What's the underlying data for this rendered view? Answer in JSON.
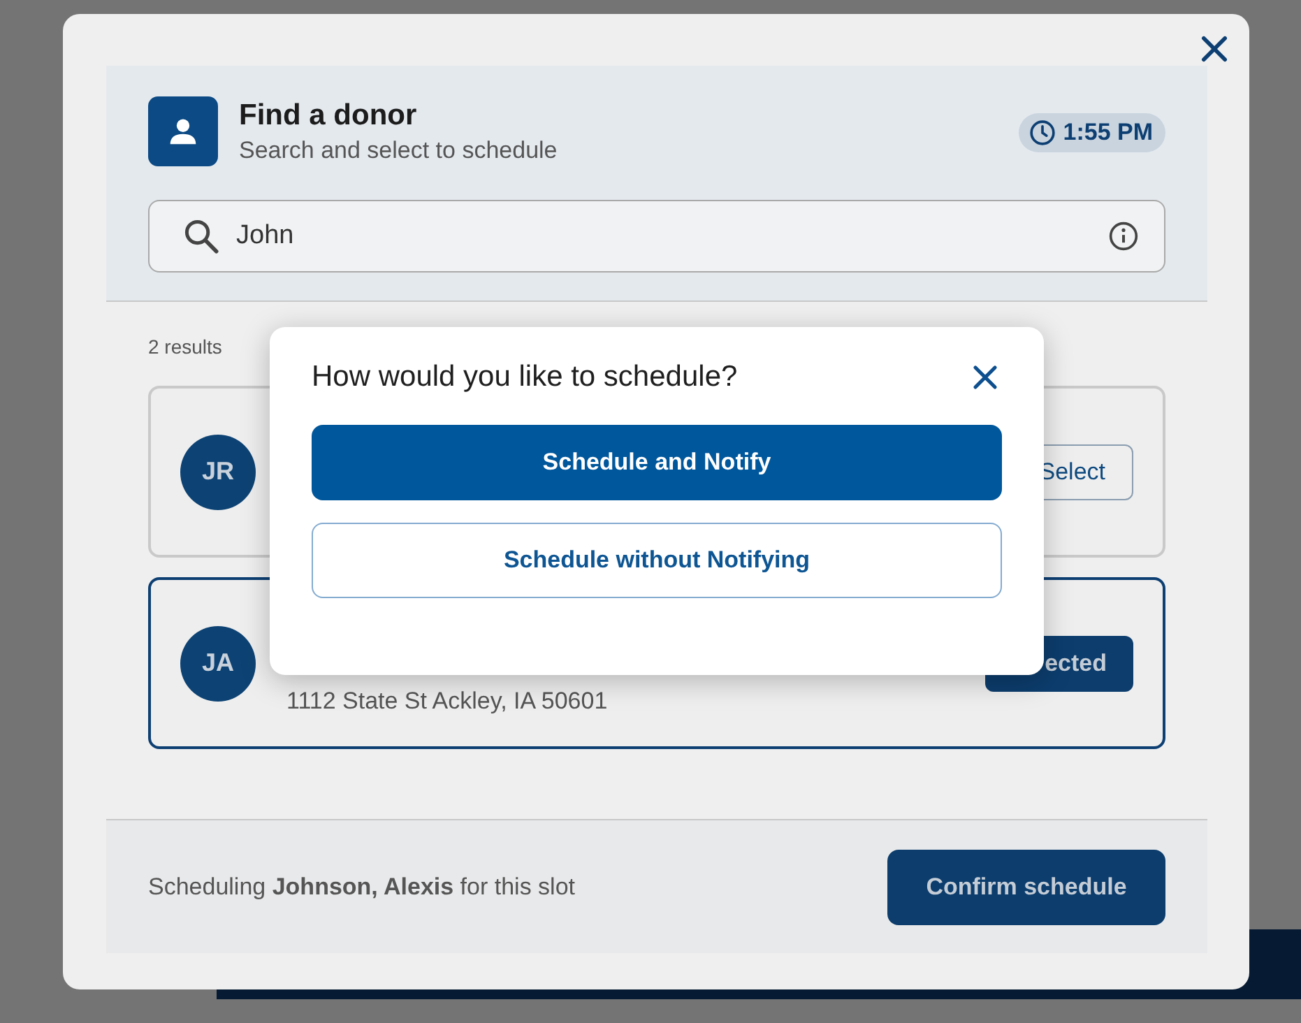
{
  "header": {
    "title": "Find a donor",
    "subtitle": "Search and select to schedule",
    "time": "1:55 PM"
  },
  "search": {
    "value": "John"
  },
  "results_count": "2 results",
  "results": [
    {
      "initials": "JR",
      "button": "Select",
      "selected": false
    },
    {
      "initials": "JA",
      "address": "1112 State St Ackley, IA 50601",
      "button": "ected",
      "selected": true
    }
  ],
  "footer": {
    "text": "Scheduling **Johnson, Alexis** for this slot",
    "button": "Confirm schedule"
  },
  "dialog": {
    "title": "How would you like to schedule?",
    "options": [
      {
        "label": "Schedule and Notify",
        "kind": "primary"
      },
      {
        "label": "Schedule without Notifying",
        "kind": "secondary"
      }
    ]
  }
}
